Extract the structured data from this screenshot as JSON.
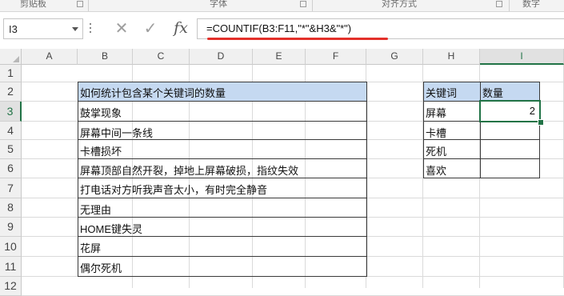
{
  "ribbon": {
    "groups": [
      "剪贴板",
      "字体",
      "对齐方式",
      "数字"
    ]
  },
  "formula_bar": {
    "name_box": "I3",
    "cancel_icon": "✕",
    "enter_icon": "✓",
    "fx_label": "fx",
    "formula": "=COUNTIF(B3:F11,\"*\"&H3&\"*\")"
  },
  "columns": [
    "A",
    "B",
    "C",
    "D",
    "E",
    "F",
    "G",
    "H",
    "I"
  ],
  "rows": [
    "1",
    "2",
    "3",
    "4",
    "5",
    "6",
    "7",
    "8",
    "9",
    "10",
    "11",
    "12"
  ],
  "selected_cell": {
    "column": "I",
    "row": "3"
  },
  "table_left": {
    "header": "如何统计包含某个关键词的数量",
    "items": [
      "鼓掌现象",
      "屏幕中间一条线",
      "卡槽损坏",
      "屏幕顶部自然开裂，掉地上屏幕破损，指纹失效",
      "打电话对方听我声音太小，有时完全静音",
      "无理由",
      "HOME键失灵",
      "花屏",
      "偶尔死机"
    ]
  },
  "table_right": {
    "headers": [
      "关键词",
      "数量"
    ],
    "rows": [
      {
        "keyword": "屏幕",
        "count": "2"
      },
      {
        "keyword": "卡槽",
        "count": ""
      },
      {
        "keyword": "死机",
        "count": ""
      },
      {
        "keyword": "喜欢",
        "count": ""
      }
    ]
  },
  "colors": {
    "header_fill": "#c5d9f1",
    "selection": "#217346",
    "annotation_underline": "#e3302a"
  }
}
